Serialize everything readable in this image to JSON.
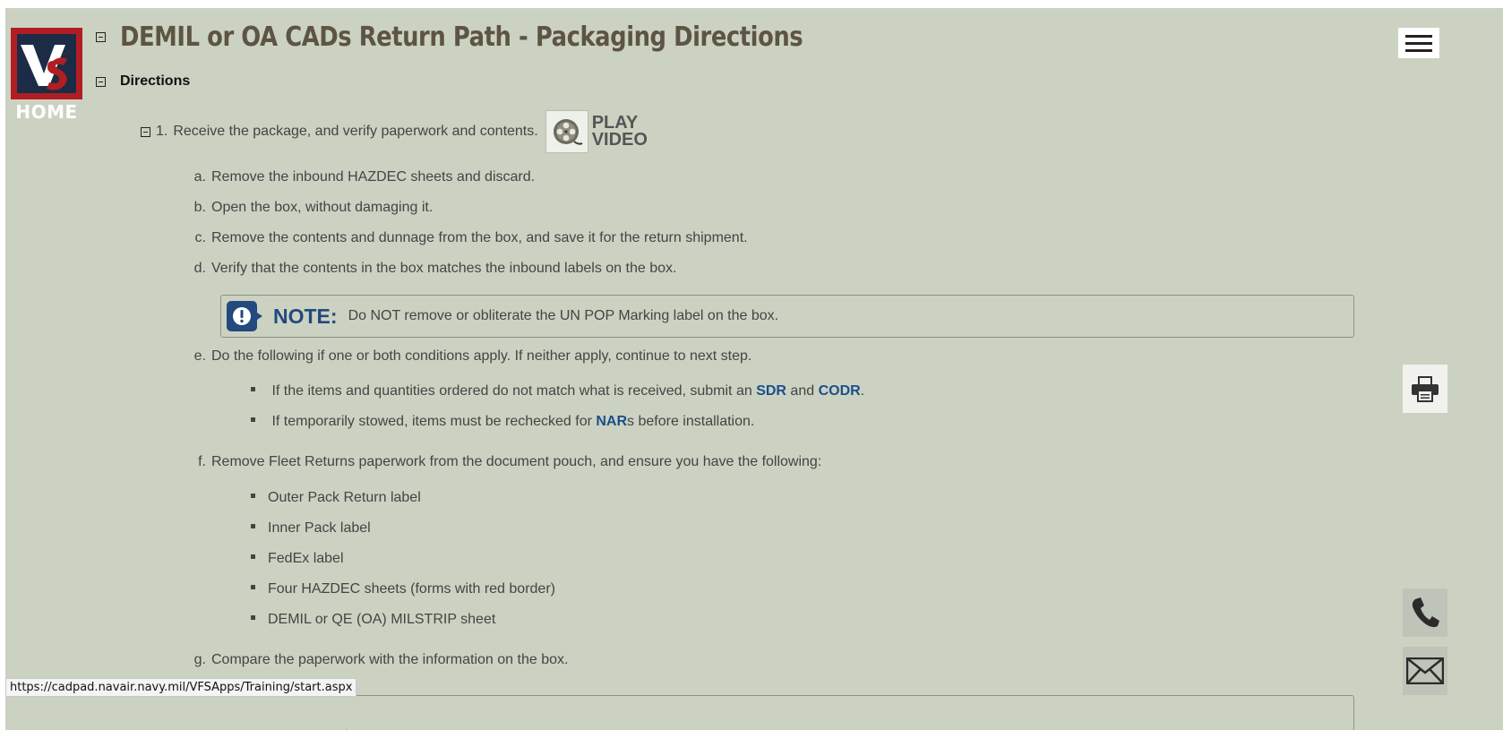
{
  "logo": {
    "monogram": "VS",
    "home_label": "HOME",
    "colors": {
      "frame": "#b01e23",
      "inner": "#1c2c46"
    }
  },
  "header": {
    "title": "DEMIL or OA CADs Return Path - Packaging Directions",
    "section": "Directions"
  },
  "step1": {
    "number": "1.",
    "text": "Receive the package, and verify paperwork and contents.",
    "play_video": {
      "line1": "PLAY",
      "line2": "VIDEO"
    }
  },
  "items": {
    "a": {
      "marker": "a.",
      "text": "Remove the inbound HAZDEC sheets and discard."
    },
    "b": {
      "marker": "b.",
      "text": "Open the box, without damaging it."
    },
    "c": {
      "marker": "c.",
      "text": "Remove the contents and dunnage from the box, and save it for the return shipment."
    },
    "d": {
      "marker": "d.",
      "text": "Verify that the contents in the box matches the inbound labels on the box."
    },
    "e": {
      "marker": "e.",
      "text": "Do the following if one or both conditions apply. If neither apply, continue to next step."
    },
    "f": {
      "marker": "f.",
      "text": "Remove Fleet Returns paperwork from the document pouch, and ensure you have the following:"
    },
    "g": {
      "marker": "g.",
      "text": "Compare the paperwork with the information on the box."
    }
  },
  "note": {
    "label": "NOTE:",
    "text": "Do NOT remove or obliterate the UN POP Marking label on the box."
  },
  "e_bullets": {
    "b1": {
      "pre": "If the items and quantities ordered do not match what is received, submit an ",
      "link1": "SDR",
      "mid": " and ",
      "link2": "CODR",
      "post": "."
    },
    "b2": {
      "pre": "If temporarily stowed, items must be rechecked for ",
      "link": "NAR",
      "post": "s before installation."
    }
  },
  "f_bullets": [
    "Outer Pack Return label",
    "Inner Pack label",
    "FedEx label",
    "Four HAZDEC sheets (forms with red border)",
    "DEMIL or QE (OA) MILSTRIP sheet"
  ],
  "status_bar": {
    "url": "https://cadpad.navair.navy.mil/VFSApps/Training/start.aspx"
  },
  "icons": [
    "collapse-icon",
    "film-reel-icon",
    "exclamation-icon",
    "hamburger-menu-icon",
    "printer-icon",
    "phone-icon",
    "envelope-icon"
  ],
  "colors": {
    "background": "#ccd2c2",
    "title": "#5e5443",
    "link": "#1b4f8a",
    "note": "#23497f"
  }
}
